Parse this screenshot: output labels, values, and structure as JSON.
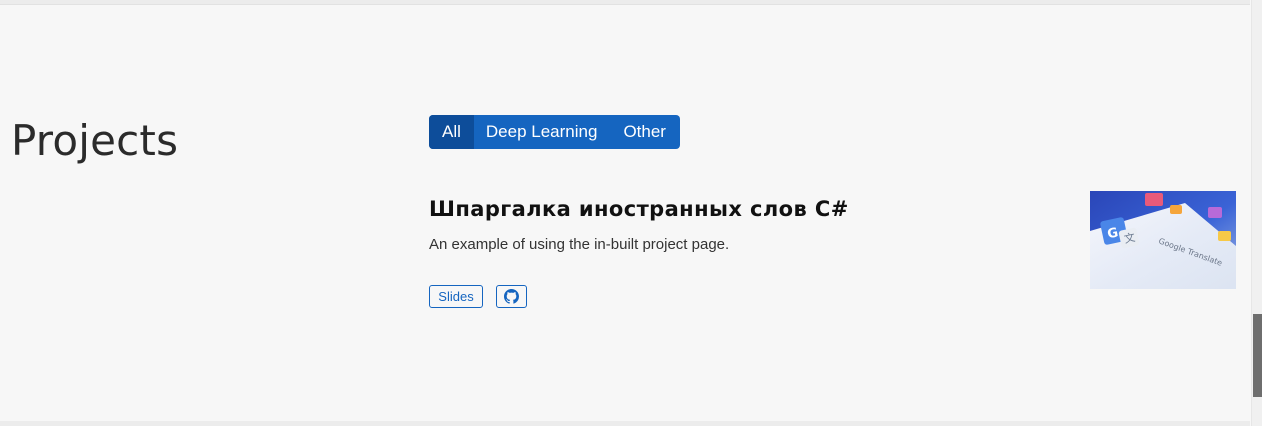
{
  "section": {
    "title": "Projects"
  },
  "filters": [
    {
      "label": "All",
      "active": true
    },
    {
      "label": "Deep Learning",
      "active": false
    },
    {
      "label": "Other",
      "active": false
    }
  ],
  "project": {
    "title": "Шпаргалка иностранных слов C#",
    "description": "An example of using the in-built project page.",
    "buttons": {
      "slides_label": "Slides",
      "github_icon": "github-icon"
    },
    "thumbnail": {
      "text": "Google Translate"
    }
  },
  "colors": {
    "background": "#f7f7f7",
    "accent": "#1565c0",
    "accent_active": "#0d4d9a"
  }
}
